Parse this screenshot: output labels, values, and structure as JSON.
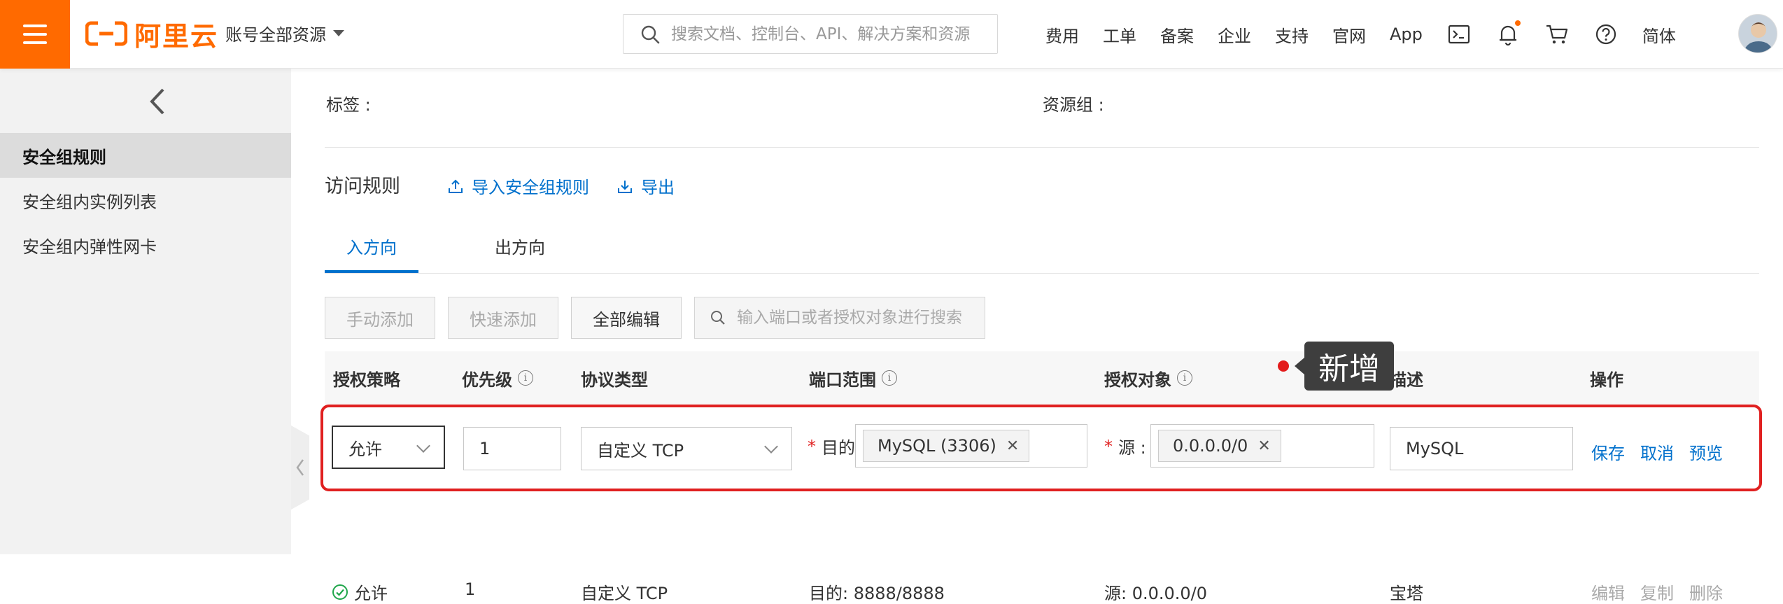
{
  "topbar": {
    "brand": "阿里云",
    "account_label": "账号全部资源",
    "search_placeholder": "搜索文档、控制台、API、解决方案和资源",
    "nav": [
      "费用",
      "工单",
      "备案",
      "企业",
      "支持",
      "官网",
      "App"
    ],
    "lang": "简体",
    "accent": "#ff6a00"
  },
  "sidebar": {
    "items": [
      {
        "label": "安全组规则",
        "active": true
      },
      {
        "label": "安全组内实例列表"
      },
      {
        "label": "安全组内弹性网卡"
      }
    ]
  },
  "main": {
    "tags_label": "标签 :",
    "resource_group_label": "资源组 :",
    "section_title": "访问规则",
    "import_label": "导入安全组规则",
    "export_label": "导出",
    "tabs": [
      {
        "label": "入方向",
        "active": true
      },
      {
        "label": "出方向"
      }
    ],
    "buttons": {
      "manual_add": "手动添加",
      "quick_add": "快速添加",
      "edit_all": "全部编辑"
    },
    "rule_search_placeholder": "输入端口或者授权对象进行搜索",
    "tooltip": "新增",
    "columns": {
      "policy": "授权策略",
      "priority": "优先级",
      "protocol": "协议类型",
      "port_range": "端口范围",
      "auth_object": "授权对象",
      "description": "描述",
      "actions": "操作"
    },
    "edit_row": {
      "policy": "允许",
      "priority": "1",
      "protocol": "自定义 TCP",
      "dest_label": "目的",
      "dest_tag": "MySQL (3306)",
      "source_label": "源 :",
      "source_tag": "0.0.0.0/0",
      "description": "MySQL",
      "save": "保存",
      "cancel": "取消",
      "preview": "预览"
    },
    "rows": [
      {
        "policy": "允许",
        "priority": "1",
        "protocol": "自定义 TCP",
        "port": "目的: 8888/8888",
        "source": "源: 0.0.0.0/0",
        "description": "宝塔",
        "edit": "编辑",
        "copy": "复制",
        "delete": "删除"
      }
    ]
  }
}
